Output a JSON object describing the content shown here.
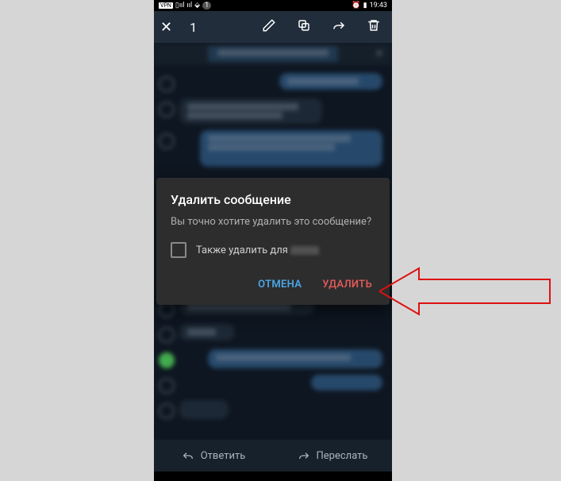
{
  "status": {
    "time": "19:43",
    "vpn": "VPN",
    "battery": "57"
  },
  "selection": {
    "count": "1"
  },
  "pinned": {
    "text_placeholder": "закреплённое сообщение"
  },
  "dialog": {
    "title": "Удалить сообщение",
    "body": "Вы точно хотите удалить это сообщение?",
    "also_delete_prefix": "Также удалить для",
    "cancel": "ОТМЕНА",
    "delete": "УДАЛИТЬ"
  },
  "bottom": {
    "reply": "Ответить",
    "forward": "Переслать"
  }
}
